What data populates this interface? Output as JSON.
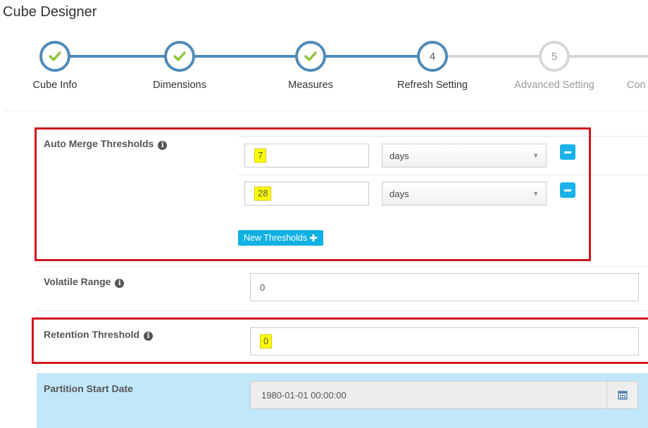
{
  "page": {
    "title": "Cube Designer"
  },
  "wizard": {
    "steps": [
      {
        "label": "Cube Info",
        "marker": "",
        "state": "done"
      },
      {
        "label": "Dimensions",
        "marker": "",
        "state": "done"
      },
      {
        "label": "Measures",
        "marker": "",
        "state": "done"
      },
      {
        "label": "Refresh Setting",
        "marker": "4",
        "state": "active"
      },
      {
        "label": "Advanced Setting",
        "marker": "5",
        "state": "todo"
      },
      {
        "label": "Con",
        "marker": "",
        "state": "todo"
      }
    ],
    "colors": {
      "done": "#4f8ab8",
      "todo": "#d7d7d7",
      "check": "#8cc43f"
    }
  },
  "auto_merge": {
    "label": "Auto Merge Thresholds",
    "thresholds": [
      {
        "value": "7",
        "unit": "days"
      },
      {
        "value": "28",
        "unit": "days"
      }
    ],
    "new_button_label": "New Thresholds"
  },
  "volatile_range": {
    "label": "Volatile Range",
    "value": "0"
  },
  "retention_threshold": {
    "label": "Retention Threshold",
    "value": "0"
  },
  "partition_start_date": {
    "label": "Partition Start Date",
    "value": "1980-01-01 00:00:00"
  },
  "colors": {
    "highlight_box": "#d0161f",
    "button": "#1ab2e8",
    "band": "#c1e8fa",
    "text_highlight": "#ffff00"
  },
  "icons": {
    "info": "info-icon",
    "check": "check-icon",
    "minus": "minus-icon",
    "plus": "plus-icon",
    "calendar": "calendar-icon",
    "caret": "caret-down-icon"
  }
}
